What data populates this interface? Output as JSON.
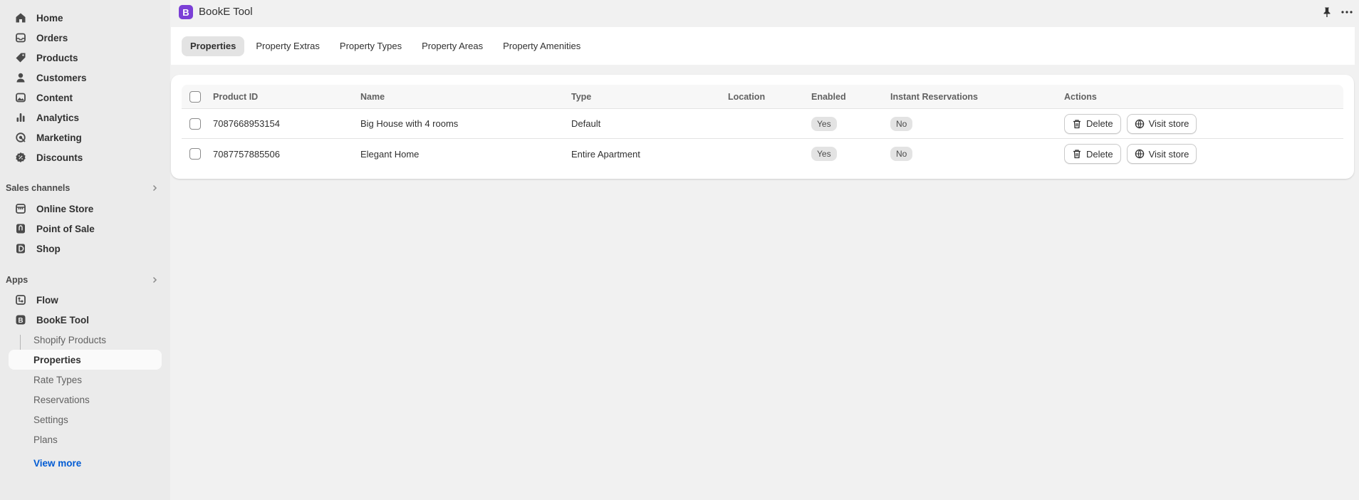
{
  "sidebar": {
    "nav": [
      {
        "label": "Home",
        "icon": "home-icon"
      },
      {
        "label": "Orders",
        "icon": "inbox-icon"
      },
      {
        "label": "Products",
        "icon": "tag-icon"
      },
      {
        "label": "Customers",
        "icon": "person-icon"
      },
      {
        "label": "Content",
        "icon": "image-icon"
      },
      {
        "label": "Analytics",
        "icon": "bar-chart-icon"
      },
      {
        "label": "Marketing",
        "icon": "target-icon"
      },
      {
        "label": "Discounts",
        "icon": "discount-icon"
      }
    ],
    "sales_channels_label": "Sales channels",
    "sales_channels": [
      {
        "label": "Online Store",
        "icon": "store-icon"
      },
      {
        "label": "Point of Sale",
        "icon": "pos-icon"
      },
      {
        "label": "Shop",
        "icon": "shop-icon"
      }
    ],
    "apps_label": "Apps",
    "apps": [
      {
        "label": "Flow",
        "icon": "flow-icon"
      },
      {
        "label": "BookE Tool",
        "icon": "booke-logo-icon"
      }
    ],
    "app_subitems": [
      "Shopify Products",
      "Properties",
      "Rate Types",
      "Reservations",
      "Settings",
      "Plans"
    ],
    "view_more": "View more"
  },
  "app_bar": {
    "logo_letter": "B",
    "title": "BookE Tool"
  },
  "tabs": [
    "Properties",
    "Property Extras",
    "Property Types",
    "Property Areas",
    "Property Amenities"
  ],
  "table": {
    "headers": {
      "product_id": "Product ID",
      "name": "Name",
      "type": "Type",
      "location": "Location",
      "enabled": "Enabled",
      "instant": "Instant Reservations",
      "actions": "Actions"
    },
    "rows": [
      {
        "product_id": "7087668953154",
        "name": "Big House with 4 rooms",
        "type": "Default",
        "location": "",
        "enabled": "Yes",
        "instant": "No"
      },
      {
        "product_id": "7087757885506",
        "name": "Elegant Home",
        "type": "Entire Apartment",
        "location": "",
        "enabled": "Yes",
        "instant": "No"
      }
    ],
    "delete_label": "Delete",
    "visit_label": "Visit store"
  },
  "colors": {
    "accent_link": "#005bd3",
    "app_logo": "#7b3fd6"
  }
}
